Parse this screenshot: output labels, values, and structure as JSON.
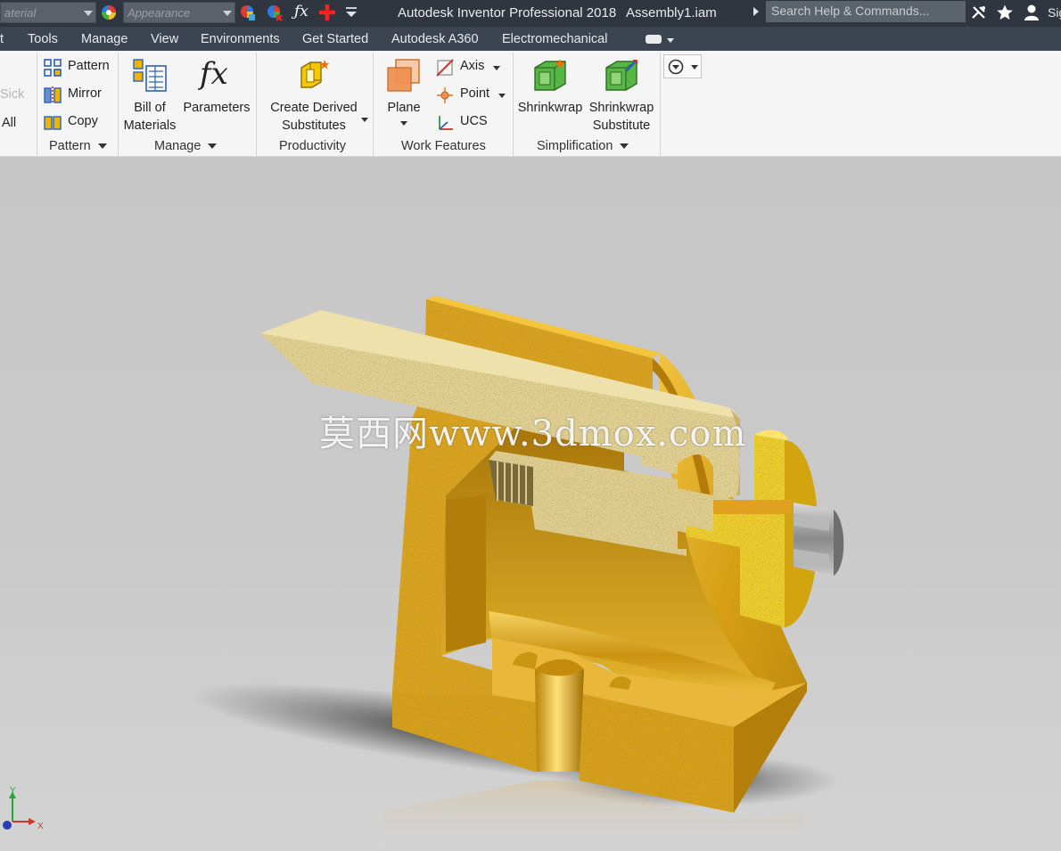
{
  "app": {
    "title": "Autodesk Inventor Professional 2018",
    "document": "Assembly1.iam",
    "search_placeholder": "Search Help & Commands...",
    "signin_label": "Sig",
    "material_placeholder": "aterial",
    "appearance_placeholder": "Appearance"
  },
  "quick_access": {
    "icons": [
      "appearance-sphere-icon",
      "adjust-appearance-icon",
      "clear-appearance-icon",
      "fx-icon",
      "add-icon",
      "customize-dropdown-icon"
    ],
    "fx_label": "ƒx"
  },
  "tabs": [
    {
      "label": "t"
    },
    {
      "label": "Tools"
    },
    {
      "label": "Manage"
    },
    {
      "label": "View"
    },
    {
      "label": "Environments"
    },
    {
      "label": "Get Started"
    },
    {
      "label": "Autodesk A360"
    },
    {
      "label": "Electromechanical"
    }
  ],
  "ribbon": {
    "cut_items": [
      "Sick",
      "All"
    ],
    "pattern_panel": {
      "title": "Pattern",
      "items": [
        {
          "label": "Pattern",
          "icon": "pattern-icon"
        },
        {
          "label": "Mirror",
          "icon": "mirror-icon"
        },
        {
          "label": "Copy",
          "icon": "copy-icon"
        }
      ]
    },
    "manage_panel": {
      "title": "Manage",
      "bom_line1": "Bill of",
      "bom_line2": "Materials",
      "parameters": "Parameters",
      "fx_glyph": "fx"
    },
    "productivity_panel": {
      "title": "Productivity",
      "line1": "Create Derived",
      "line2": "Substitutes"
    },
    "work_features_panel": {
      "title": "Work Features",
      "plane": "Plane",
      "axis": "Axis",
      "point": "Point",
      "ucs": "UCS"
    },
    "simplification_panel": {
      "title": "Simplification",
      "shrinkwrap": "Shrinkwrap",
      "sub_line1": "Shrinkwrap",
      "sub_line2": "Substitute"
    }
  },
  "viewport": {
    "watermark": "莫西网www.3dmox.com",
    "triad": {
      "x_label": "X",
      "y_label": "Y"
    }
  },
  "colors": {
    "titlebar": "#2f3640",
    "tabbar": "#3b4450",
    "ribbon": "#f5f5f5",
    "base_part": "#d9a418",
    "pointer_part": "#e4d49a"
  }
}
